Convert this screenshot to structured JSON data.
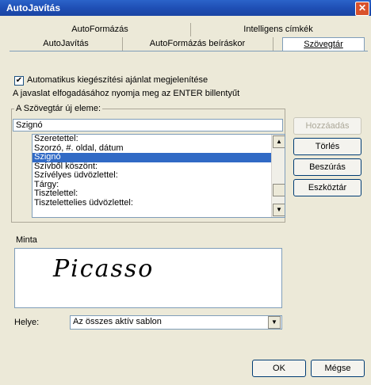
{
  "window": {
    "title": "AutoJavítás",
    "close": "✕"
  },
  "tabs_back": [
    {
      "label": "AutoFormázás"
    },
    {
      "label": "Intelligens címkék"
    }
  ],
  "tabs_front": [
    {
      "label": "AutoJavítás"
    },
    {
      "label": "AutoFormázás beíráskor"
    },
    {
      "label": "Szövegtár"
    }
  ],
  "options": {
    "show_autocomplete_label": "Automatikus kiegészítési ajánlat megjelenítése",
    "show_autocomplete_checked": "✔",
    "hint": "A javaslat elfogadásához nyomja meg az ENTER billentyűt"
  },
  "group": {
    "label": "A Szövegtár új eleme:",
    "input_value": "Szignó",
    "items": [
      "Szeretettel:",
      "Szorzó, #. oldal, dátum",
      "Szignó",
      "Szívből köszönt:",
      "Szívélyes üdvözlettel:",
      "Tárgy:",
      "Tisztelettel:",
      "Tisztelettelies üdvözlettel:"
    ],
    "selected_index": 2
  },
  "buttons": {
    "add": "Hozzáadás",
    "delete": "Törlés",
    "insert": "Beszúrás",
    "toolbar": "Eszköztár",
    "ok": "OK",
    "cancel": "Mégse"
  },
  "preview": {
    "label": "Minta",
    "signature_text": "Picasso"
  },
  "location": {
    "label": "Helye:",
    "value": "Az összes aktív sablon"
  }
}
